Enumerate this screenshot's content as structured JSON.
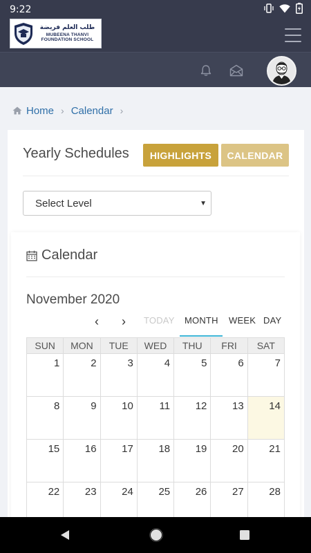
{
  "status": {
    "time": "9:22"
  },
  "logo": {
    "arabic": "طلب العلم فريضة",
    "line1": "MUBEENA THANVI",
    "line2": "FOUNDATION SCHOOL"
  },
  "breadcrumb": {
    "home": "Home",
    "current": "Calendar"
  },
  "schedules": {
    "title": "Yearly Schedules",
    "highlights_label": "HIGHLIGHTS",
    "calendar_label": "CALENDAR",
    "select_value": "Select Level"
  },
  "calendar": {
    "title": "Calendar",
    "month_title": "November 2020",
    "prev": "‹",
    "next": "›",
    "today_label": "TODAY",
    "views": {
      "month": "MONTH",
      "week": "WEEK",
      "day": "DAY"
    },
    "active_view": "MONTH",
    "weekdays": [
      "SUN",
      "MON",
      "TUE",
      "WED",
      "THU",
      "FRI",
      "SAT"
    ],
    "weeks": [
      [
        "1",
        "2",
        "3",
        "4",
        "5",
        "6",
        "7"
      ],
      [
        "8",
        "9",
        "10",
        "11",
        "12",
        "13",
        "14"
      ],
      [
        "15",
        "16",
        "17",
        "18",
        "19",
        "20",
        "21"
      ],
      [
        "22",
        "23",
        "24",
        "25",
        "26",
        "27",
        "28"
      ]
    ],
    "highlighted_day": "14"
  },
  "colors": {
    "header_bg": "#373b4d",
    "highlight_btn": "#c8a23b",
    "calendar_btn": "#dcc485",
    "link": "#2f6fa8",
    "today_bg": "#fcf8e3",
    "active_tab": "#3cb4d6"
  }
}
